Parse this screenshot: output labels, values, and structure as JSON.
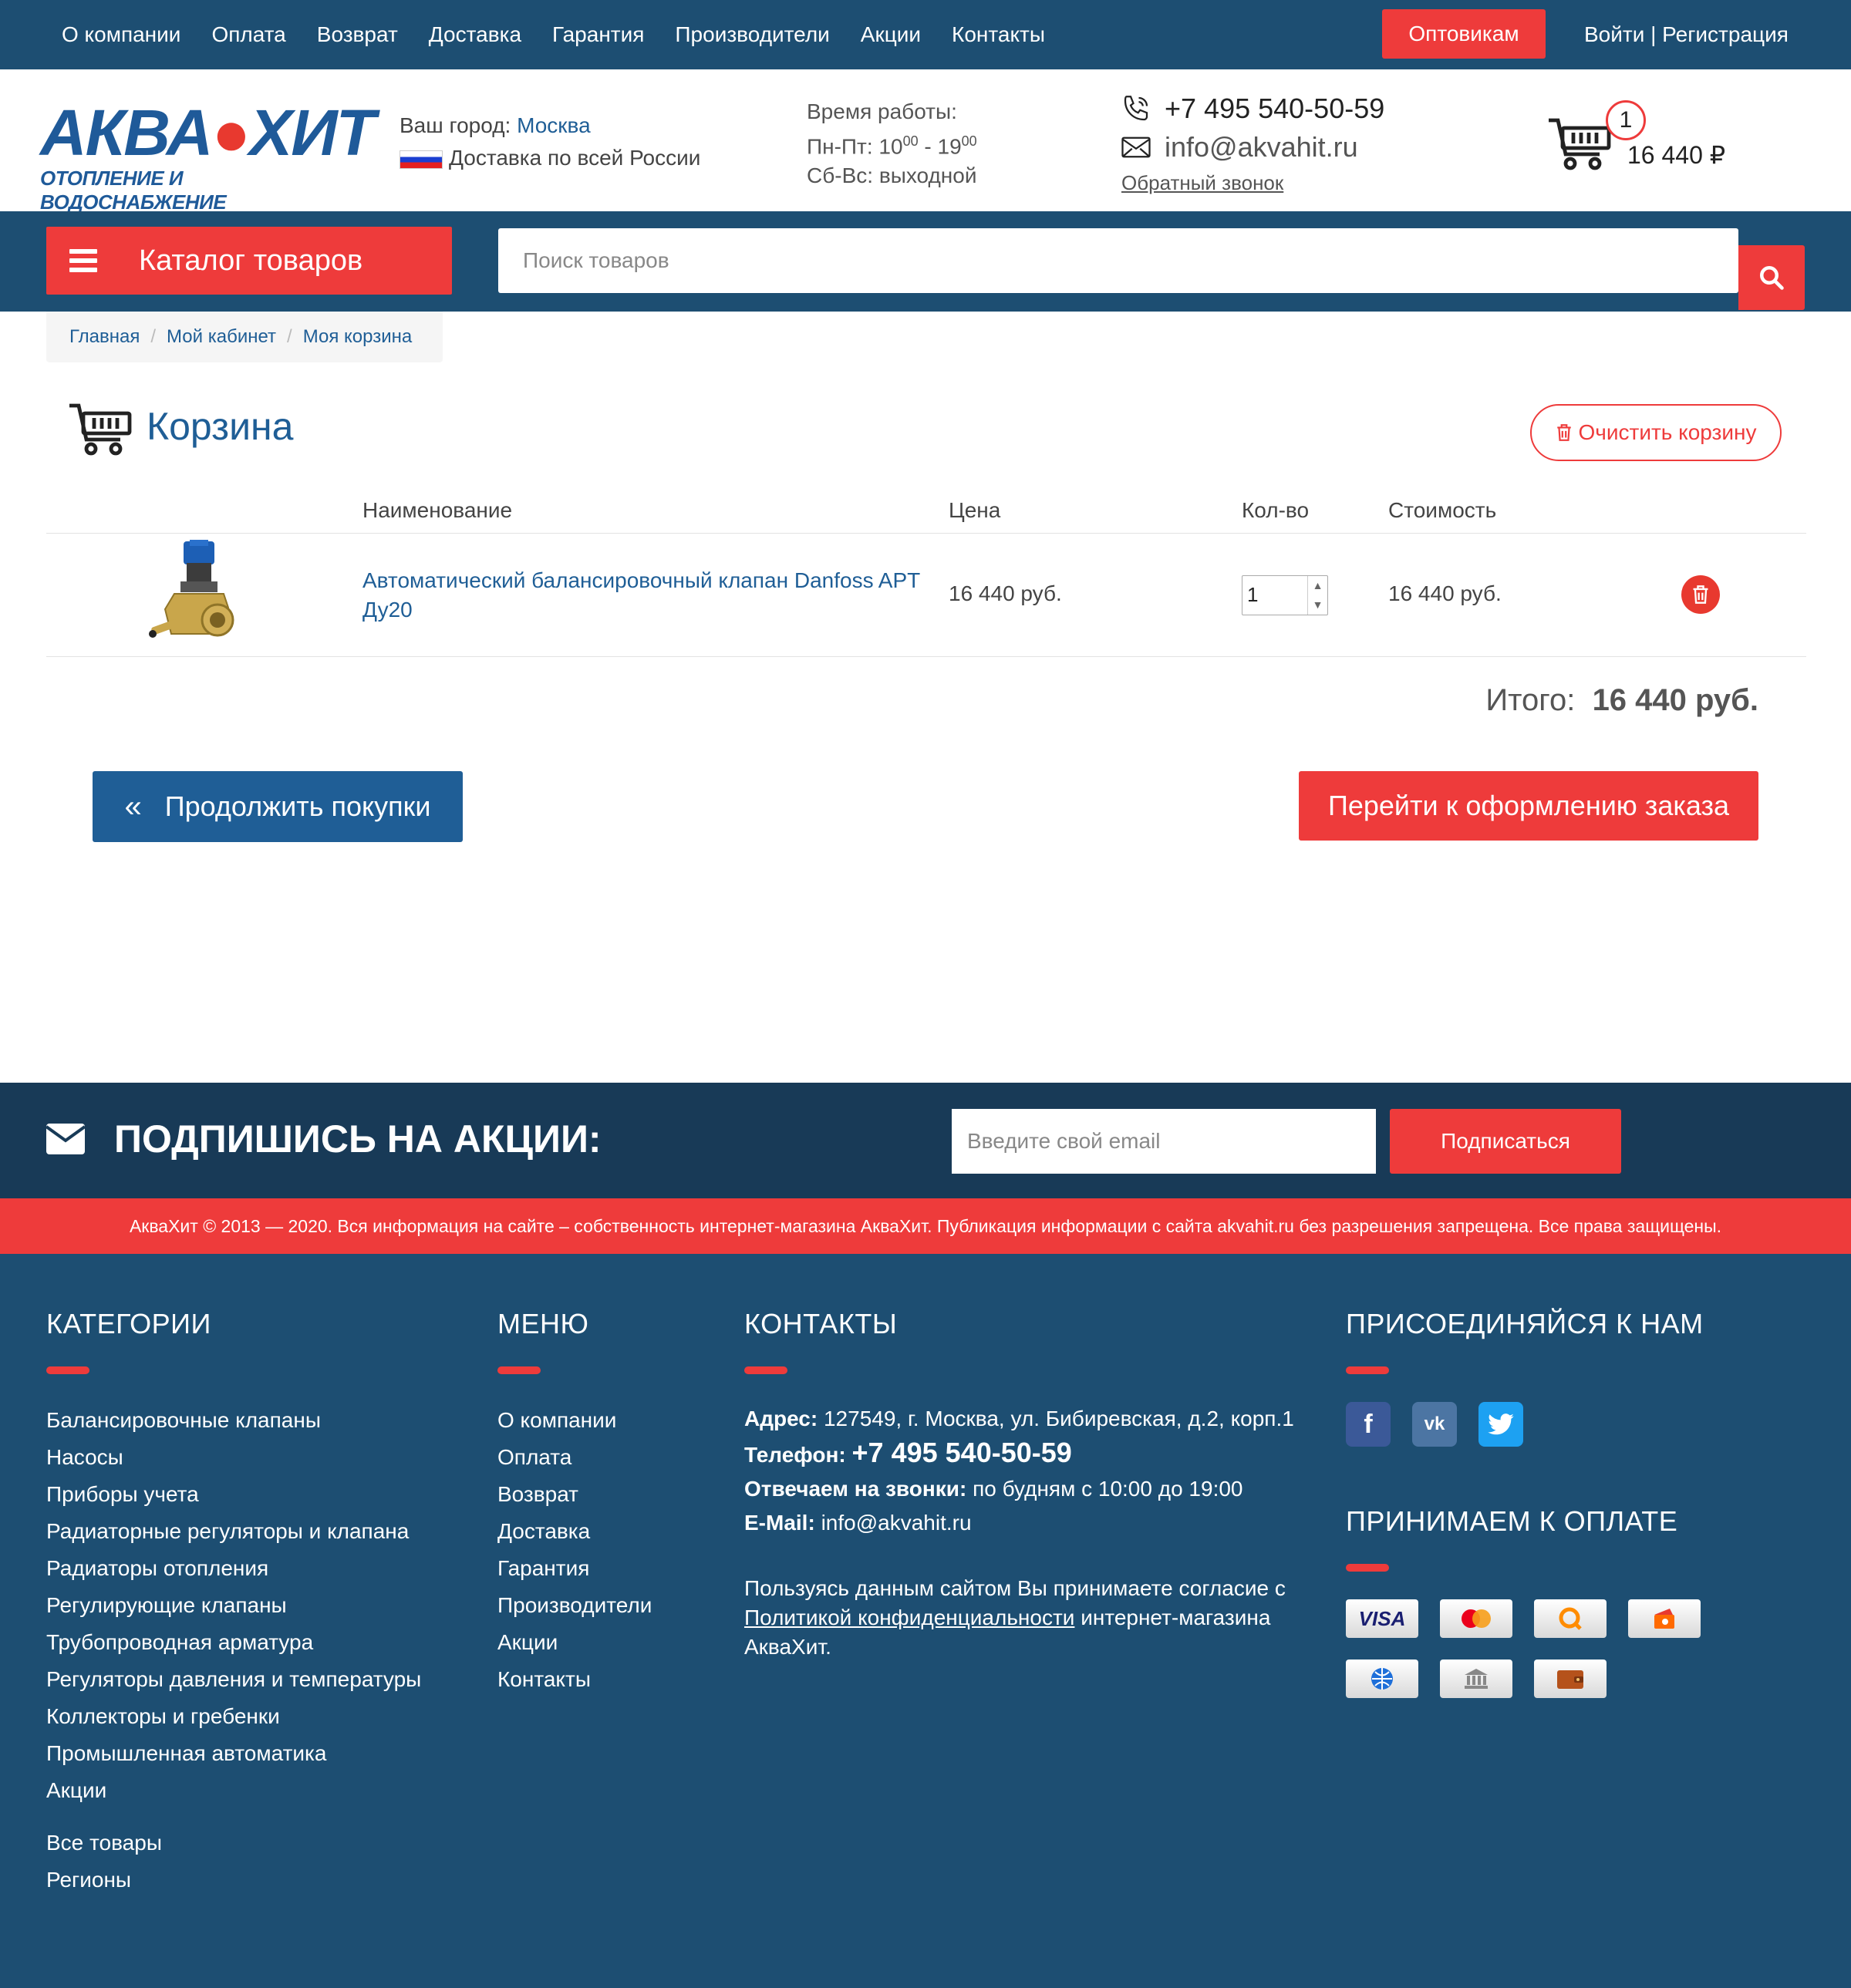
{
  "topnav": {
    "items": [
      "О компании",
      "Оплата",
      "Возврат",
      "Доставка",
      "Гарантия",
      "Производители",
      "Акции",
      "Контакты"
    ],
    "wholesale": "Оптовикам",
    "login": "Войти | Регистрация"
  },
  "header": {
    "logo_main_a": "АКВА",
    "logo_main_b": "ХИТ",
    "logo_sub": "ОТОПЛЕНИЕ И ВОДОСНАБЖЕНИЕ",
    "city_label": "Ваш город:",
    "city": "Москва",
    "delivery": "Доставка по всей России",
    "hours_label": "Время работы:",
    "hours_weekdays_prefix": "Пн-Пт: 10",
    "hours_weekdays_sup1": "00",
    "hours_weekdays_mid": " - 19",
    "hours_weekdays_sup2": "00",
    "hours_weekend": "Сб-Вс: выходной",
    "phone": "+7 495 540-50-59",
    "email": "info@akvahit.ru",
    "callback": "Обратный звонок",
    "cart_count": "1",
    "cart_total": "16 440 ₽"
  },
  "catalog": {
    "button": "Каталог товаров",
    "search_placeholder": "Поиск товаров"
  },
  "breadcrumb": [
    "Главная",
    "Мой кабинет",
    "Моя корзина"
  ],
  "cart": {
    "title": "Корзина",
    "clear": "Очистить корзину",
    "columns": {
      "name": "Наименование",
      "price": "Цена",
      "qty": "Кол-во",
      "sum": "Стоимость"
    },
    "items": [
      {
        "name": "Автоматический балансировочный клапан Danfoss APT Ду20",
        "price": "16 440 руб.",
        "qty": "1",
        "sum": "16 440 руб."
      }
    ],
    "total_label": "Итого:",
    "total_value": "16 440 руб.",
    "continue": "Продолжить покупки",
    "checkout": "Перейти к оформлению заказа"
  },
  "subscribe": {
    "title": "ПОДПИШИСЬ НА АКЦИИ:",
    "placeholder": "Введите свой email",
    "button": "Подписаться"
  },
  "copyright": "АкваХит © 2013 — 2020. Вся информация на сайте – собственность интернет-магазина АкваХит. Публикация информации с сайта akvahit.ru без разрешения запрещена. Все права защищены.",
  "footer": {
    "categories_title": "КАТЕГОРИИ",
    "categories": [
      "Балансировочные клапаны",
      "Насосы",
      "Приборы учета",
      "Радиаторные регуляторы и клапана",
      "Радиаторы отопления",
      "Регулирующие клапаны",
      "Трубопроводная арматура",
      "Регуляторы давления и температуры",
      "Коллекторы и гребенки",
      "Промышленная автоматика",
      "Акции"
    ],
    "extra_links": [
      "Все товары",
      "Регионы"
    ],
    "menu_title": "МЕНЮ",
    "menu": [
      "О компании",
      "Оплата",
      "Возврат",
      "Доставка",
      "Гарантия",
      "Производители",
      "Акции",
      "Контакты"
    ],
    "contacts_title": "КОНТАКТЫ",
    "address_label": "Адрес:",
    "address": "127549, г. Москва, ул. Бибиревская, д.2, корп.1",
    "phone_label": "Телефон:",
    "phone": "+7 495 540-50-59",
    "calls_label": "Отвечаем на звонки:",
    "calls": "по будням с 10:00 до 19:00",
    "email_label": "E-Mail:",
    "email": "info@akvahit.ru",
    "policy_pre": "Пользуясь данным сайтом Вы принимаете согласие с ",
    "policy_link": "Политикой конфиденциальности",
    "policy_post": " интернет-магазина АкваХит.",
    "join_title": "ПРИСОЕДИНЯЙСЯ К НАМ",
    "payment_title": "ПРИНИМАЕМ К ОПЛАТЕ",
    "payment_visa": "VISA"
  },
  "colors": {
    "primary_blue": "#1d4e72",
    "accent_red": "#ee3b3b",
    "link_blue": "#1f5e96"
  }
}
